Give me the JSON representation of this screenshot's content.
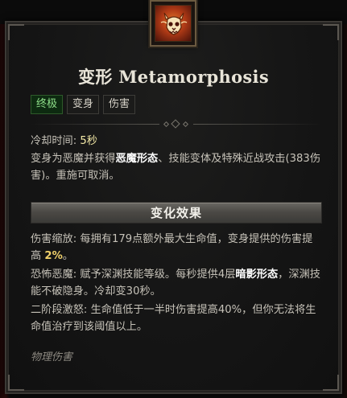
{
  "title": "变形 Metamorphosis",
  "tags": [
    "终极",
    "变身",
    "伤害"
  ],
  "cooldown": {
    "label": "冷却时间: ",
    "value": "5秒"
  },
  "description": {
    "p1": "变身为恶魔并获得",
    "strong": "恶魔形态",
    "p2": "、技能变体及特殊近战攻击(383伤害)。重施可取消。"
  },
  "section_header": "变化效果",
  "effects": {
    "e1": {
      "prefix": "伤害缩放: 每拥有179点额外最大生命值，变身提供的伤害提高 ",
      "value": "2%",
      "suffix": "。"
    },
    "e2": {
      "prefix": "恐怖恶魔: 赋予深渊技能等级。每秒提供4层",
      "strong": "暗影形态",
      "suffix": "，深渊技能不破隐身。冷却变30秒。"
    },
    "e3": "二阶段激怒: 生命值低于一半时伤害提高40%，但你无法将生命值治疗到该阈值以上。"
  },
  "footer": "物理伤害",
  "colors": {
    "active_tag": "#8fe08a",
    "highlight": "#f3e8a6",
    "percent": "#f0d06a"
  },
  "icon": "demon-skull-icon"
}
